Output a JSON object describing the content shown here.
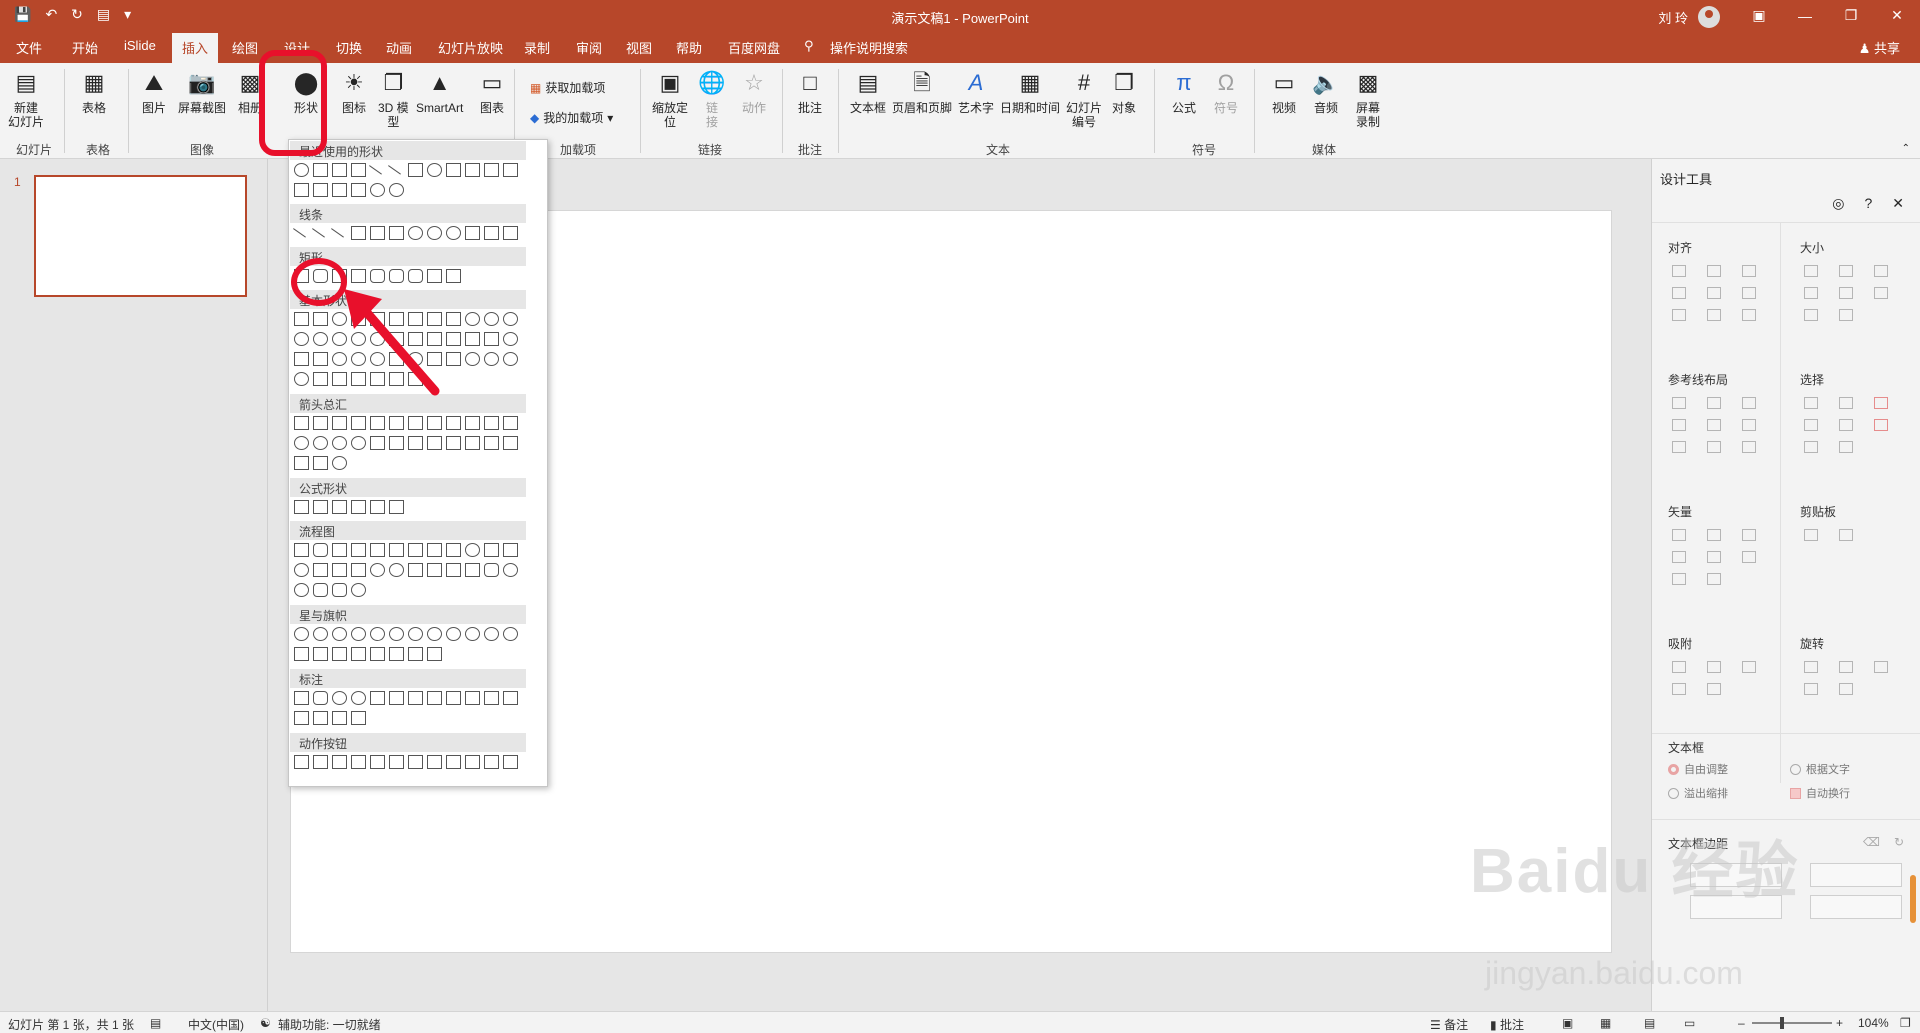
{
  "titlebar": {
    "doc_title": "演示文稿1  -  PowerPoint",
    "user_name": "刘 玲",
    "qa_icons": [
      "save-icon",
      "undo-icon",
      "redo-icon",
      "start-slideshow-icon",
      "customize-icon"
    ]
  },
  "tabs": [
    "文件",
    "开始",
    "iSlide",
    "插入",
    "绘图",
    "设计",
    "切换",
    "动画",
    "幻灯片放映",
    "录制",
    "审阅",
    "视图",
    "帮助",
    "百度网盘",
    "操作说明搜索"
  ],
  "active_tab": "插入",
  "share_label": "共享",
  "ribbon": {
    "new_slide": "新建\n幻灯片",
    "table": "表格",
    "picture": "图片",
    "screenshot": "屏幕截图",
    "album": "相册",
    "shapes": "形状",
    "icons": "图标",
    "model3d": "3D 模\n型",
    "smartart": "SmartArt",
    "chart": "图表",
    "get_addins": "获取加载项",
    "my_addins": "我的加载项",
    "zoom": "缩放定\n位",
    "link": "链\n接",
    "action": "动作",
    "comment": "批注",
    "textbox": "文本框",
    "header_footer": "页眉和页脚",
    "wordart": "艺术字",
    "datetime": "日期和时间",
    "slide_number": "幻灯片\n编号",
    "object": "对象",
    "equation": "公式",
    "symbol": "符号",
    "video": "视频",
    "audio": "音频",
    "screen_record": "屏幕\n录制",
    "groups": [
      "幻灯片",
      "表格",
      "图像",
      "加载项",
      "链接",
      "批注",
      "文本",
      "符号",
      "媒体"
    ]
  },
  "thumbnail_number": "1",
  "shapes_gallery": {
    "sections": [
      "最近使用的形状",
      "线条",
      "矩形",
      "基本形状",
      "箭头总汇",
      "公式形状",
      "流程图",
      "星与旗帜",
      "标注",
      "动作按钮"
    ]
  },
  "design_pane": {
    "title": "设计工具",
    "sections": [
      "对齐",
      "大小",
      "参考线布局",
      "选择",
      "矢量",
      "剪贴板",
      "吸附",
      "旋转",
      "文本框",
      "文本框边距"
    ],
    "textbox_options": [
      "自由调整",
      "根据文字",
      "溢出缩排",
      "自动换行"
    ]
  },
  "statusbar": {
    "slide_info": "幻灯片 第 1 张，共 1 张",
    "language": "中文(中国)",
    "accessibility": "辅助功能: 一切就绪",
    "notes": "备注",
    "comments": "批注",
    "zoom": "104%"
  },
  "watermark": {
    "brand": "Baidu 经验",
    "url": "jingyan.baidu.com"
  },
  "colors": {
    "accent": "#b7472a",
    "highlight": "#e8102b"
  }
}
